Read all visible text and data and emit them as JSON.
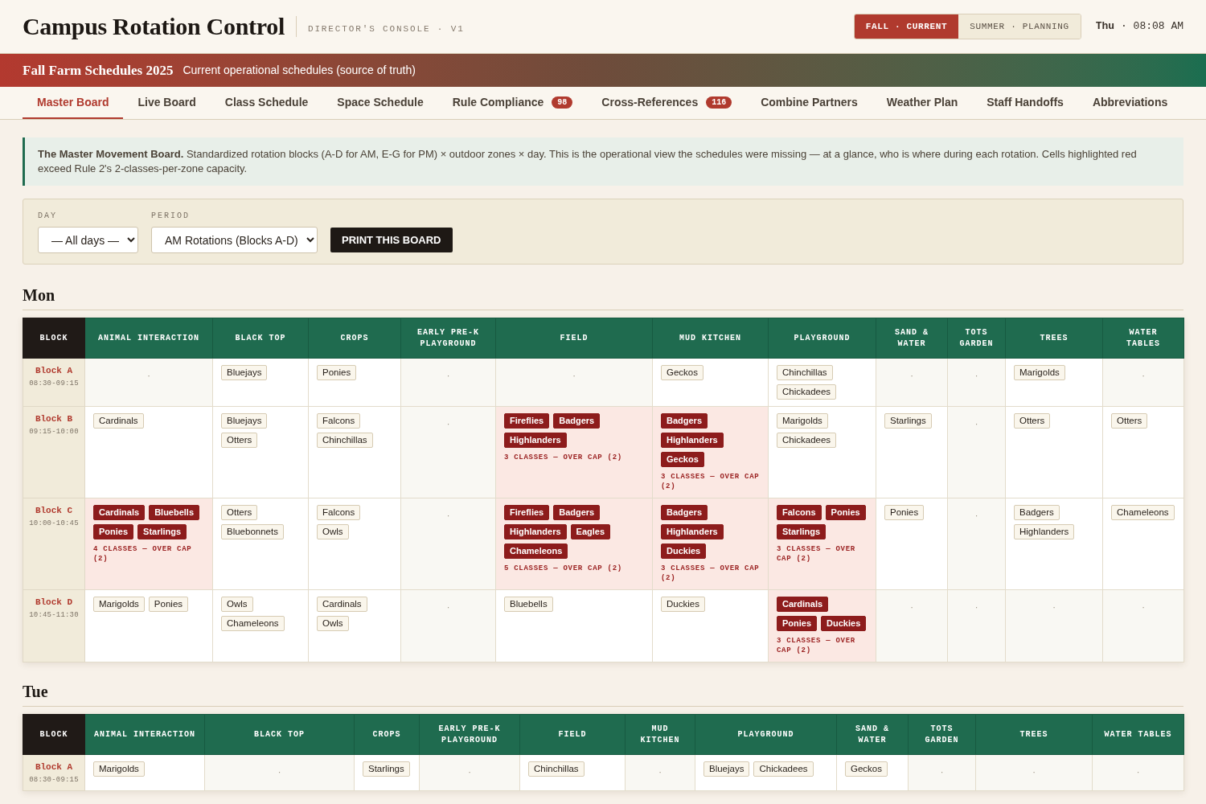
{
  "header": {
    "title": "Campus Rotation Control",
    "subtitle": "DIRECTOR'S CONSOLE · V1",
    "seasons": [
      {
        "label": "FALL · CURRENT",
        "selected": true
      },
      {
        "label": "SUMMER · PLANNING",
        "selected": false
      }
    ],
    "clock": "**Thu** · 08:08 AM"
  },
  "banner": {
    "title": "Fall Farm Schedules 2025",
    "subtitle": "Current operational schedules (source of truth)"
  },
  "tabs": [
    {
      "label": "Master Board",
      "selected": true
    },
    {
      "label": "Live Board",
      "selected": false
    },
    {
      "label": "Class Schedule",
      "selected": false
    },
    {
      "label": "Space Schedule",
      "selected": false
    },
    {
      "label": "Rule Compliance",
      "badge": "98",
      "selected": false
    },
    {
      "label": "Cross-References",
      "badge": "116",
      "selected": false
    },
    {
      "label": "Combine Partners",
      "selected": false
    },
    {
      "label": "Weather Plan",
      "selected": false
    },
    {
      "label": "Staff Handoffs",
      "selected": false
    },
    {
      "label": "Abbreviations",
      "selected": false
    }
  ],
  "intro": "**The Master Movement Board.** Standardized rotation blocks (A-D for AM, E-G for PM) × outdoor zones × day. This is the operational view the schedules were missing — at a glance, who is where during each rotation. Cells highlighted red exceed Rule 2's 2-classes-per-zone capacity.",
  "filters": {
    "fields": [
      {
        "label": "DAY",
        "value": "— All days —"
      },
      {
        "label": "PERIOD",
        "value": "AM Rotations (Blocks A-D)"
      }
    ],
    "button": "PRINT THIS BOARD"
  },
  "days": [
    {
      "title": "Mon",
      "block_header": "BLOCK",
      "columns": [
        "ANIMAL INTERACTION",
        "BLACK TOP",
        "CROPS",
        "EARLY PRE-K PLAYGROUND",
        "FIELD",
        "MUD KITCHEN",
        "PLAYGROUND",
        "SAND & WATER",
        "TOTS GARDEN",
        "TREES",
        "WATER TABLES"
      ],
      "rows": [
        {
          "block": "Block A",
          "time": "08:30-09:15",
          "cells": [
            {
              "kind": "empty",
              "mark": "·"
            },
            {
              "kind": "ok",
              "classes": [
                "Bluejays"
              ]
            },
            {
              "kind": "ok",
              "classes": [
                "Ponies"
              ]
            },
            {
              "kind": "empty",
              "mark": "·"
            },
            {
              "kind": "empty",
              "mark": "·"
            },
            {
              "kind": "ok",
              "classes": [
                "Geckos"
              ]
            },
            {
              "kind": "ok",
              "classes": [
                "Chinchillas",
                "Chickadees"
              ]
            },
            {
              "kind": "empty",
              "mark": "·"
            },
            {
              "kind": "empty",
              "mark": "·"
            },
            {
              "kind": "ok",
              "classes": [
                "Marigolds"
              ]
            },
            {
              "kind": "empty",
              "mark": "·"
            }
          ]
        },
        {
          "block": "Block B",
          "time": "09:15-10:00",
          "cells": [
            {
              "kind": "ok",
              "classes": [
                "Cardinals"
              ]
            },
            {
              "kind": "ok",
              "classes": [
                "Bluejays",
                "Otters"
              ]
            },
            {
              "kind": "ok",
              "classes": [
                "Falcons",
                "Chinchillas"
              ]
            },
            {
              "kind": "empty",
              "mark": "·"
            },
            {
              "kind": "over",
              "classes": [
                "Fireflies",
                "Badgers",
                "Highlanders"
              ],
              "note": "3 CLASSES — OVER CAP (2)"
            },
            {
              "kind": "over",
              "classes": [
                "Badgers",
                "Highlanders",
                "Geckos"
              ],
              "note": "3 CLASSES — OVER CAP (2)"
            },
            {
              "kind": "ok",
              "classes": [
                "Marigolds",
                "Chickadees"
              ]
            },
            {
              "kind": "ok",
              "classes": [
                "Starlings"
              ]
            },
            {
              "kind": "empty",
              "mark": "·"
            },
            {
              "kind": "ok",
              "classes": [
                "Otters"
              ]
            },
            {
              "kind": "ok",
              "classes": [
                "Otters"
              ]
            }
          ]
        },
        {
          "block": "Block C",
          "time": "10:00-10:45",
          "cells": [
            {
              "kind": "over",
              "classes": [
                "Cardinals",
                "Bluebells",
                "Ponies",
                "Starlings"
              ],
              "note": "4 CLASSES — OVER CAP (2)"
            },
            {
              "kind": "ok",
              "classes": [
                "Otters",
                "Bluebonnets"
              ]
            },
            {
              "kind": "ok",
              "classes": [
                "Falcons",
                "Owls"
              ]
            },
            {
              "kind": "empty",
              "mark": "·"
            },
            {
              "kind": "over",
              "classes": [
                "Fireflies",
                "Badgers",
                "Highlanders",
                "Eagles",
                "Chameleons"
              ],
              "note": "5 CLASSES — OVER CAP (2)"
            },
            {
              "kind": "over",
              "classes": [
                "Badgers",
                "Highlanders",
                "Duckies"
              ],
              "note": "3 CLASSES — OVER CAP (2)"
            },
            {
              "kind": "over",
              "classes": [
                "Falcons",
                "Ponies",
                "Starlings"
              ],
              "note": "3 CLASSES — OVER CAP (2)"
            },
            {
              "kind": "ok",
              "classes": [
                "Ponies"
              ]
            },
            {
              "kind": "empty",
              "mark": "·"
            },
            {
              "kind": "ok",
              "classes": [
                "Badgers",
                "Highlanders"
              ]
            },
            {
              "kind": "ok",
              "classes": [
                "Chameleons"
              ]
            }
          ]
        },
        {
          "block": "Block D",
          "time": "10:45-11:30",
          "cells": [
            {
              "kind": "ok",
              "classes": [
                "Marigolds",
                "Ponies"
              ]
            },
            {
              "kind": "ok",
              "classes": [
                "Owls",
                "Chameleons"
              ]
            },
            {
              "kind": "ok",
              "classes": [
                "Cardinals",
                "Owls"
              ]
            },
            {
              "kind": "empty",
              "mark": "·"
            },
            {
              "kind": "ok",
              "classes": [
                "Bluebells"
              ]
            },
            {
              "kind": "ok",
              "classes": [
                "Duckies"
              ]
            },
            {
              "kind": "over",
              "classes": [
                "Cardinals",
                "Ponies",
                "Duckies"
              ],
              "note": "3 CLASSES — OVER CAP (2)"
            },
            {
              "kind": "empty",
              "mark": "·"
            },
            {
              "kind": "empty",
              "mark": "·"
            },
            {
              "kind": "empty",
              "mark": "·"
            },
            {
              "kind": "empty",
              "mark": "·"
            }
          ]
        }
      ]
    },
    {
      "title": "Tue",
      "block_header": "BLOCK",
      "columns": [
        "ANIMAL INTERACTION",
        "BLACK TOP",
        "CROPS",
        "EARLY PRE-K PLAYGROUND",
        "FIELD",
        "MUD KITCHEN",
        "PLAYGROUND",
        "SAND & WATER",
        "TOTS GARDEN",
        "TREES",
        "WATER TABLES"
      ],
      "rows": [
        {
          "block": "Block A",
          "time": "08:30-09:15",
          "cells": [
            {
              "kind": "ok",
              "classes": [
                "Marigolds"
              ]
            },
            {
              "kind": "empty",
              "mark": "·"
            },
            {
              "kind": "ok",
              "classes": [
                "Starlings"
              ]
            },
            {
              "kind": "empty",
              "mark": "·"
            },
            {
              "kind": "ok",
              "classes": [
                "Chinchillas"
              ]
            },
            {
              "kind": "empty",
              "mark": "·"
            },
            {
              "kind": "ok",
              "classes": [
                "Bluejays",
                "Chickadees"
              ]
            },
            {
              "kind": "ok",
              "classes": [
                "Geckos"
              ]
            },
            {
              "kind": "empty",
              "mark": "·"
            },
            {
              "kind": "empty",
              "mark": "·"
            },
            {
              "kind": "empty",
              "mark": "·"
            }
          ]
        }
      ]
    }
  ]
}
